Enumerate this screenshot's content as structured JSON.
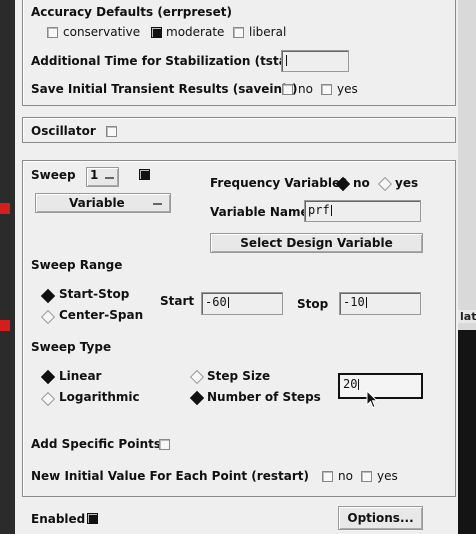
{
  "accuracy": {
    "title": "Accuracy Defaults (errpreset)",
    "options": [
      {
        "label": "conservative",
        "checked": false
      },
      {
        "label": "moderate",
        "checked": true
      },
      {
        "label": "liberal",
        "checked": false
      }
    ],
    "tstab_label": "Additional Time for Stabilization (tstab)",
    "tstab_value": "",
    "saveinit_label": "Save Initial Transient Results (saveinit)",
    "saveinit_no": "no",
    "saveinit_yes": "yes"
  },
  "oscillator": {
    "label": "Oscillator"
  },
  "sweep": {
    "label": "Sweep",
    "index": "1",
    "variable_dropdown": "Variable",
    "freq_var_label": "Frequency Variable?",
    "freq_no": "no",
    "freq_yes": "yes",
    "var_name_label": "Variable Name",
    "var_name_value": "prf",
    "select_button": "Select Design Variable",
    "range_title": "Sweep Range",
    "start_stop": "Start-Stop",
    "center_span": "Center-Span",
    "start_label": "Start",
    "start_value": "-60",
    "stop_label": "Stop",
    "stop_value": "-10",
    "type_title": "Sweep Type",
    "linear": "Linear",
    "logarithmic": "Logarithmic",
    "step_size": "Step Size",
    "number_of_steps": "Number of Steps",
    "steps_value": "20",
    "add_points_label": "Add Specific Points",
    "restart_label": "New Initial Value For Each Point (restart)",
    "restart_no": "no",
    "restart_yes": "yes"
  },
  "footer": {
    "enabled_label": "Enabled",
    "options_button": "Options..."
  },
  "partial_text": "lati"
}
